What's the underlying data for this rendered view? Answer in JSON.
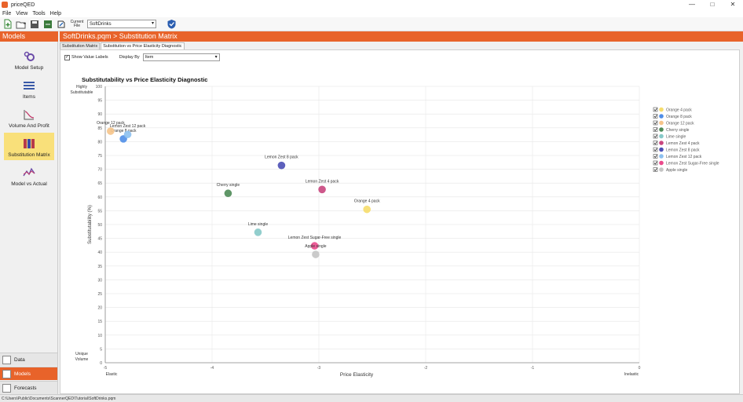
{
  "app": {
    "title": "priceQED",
    "menu": [
      "File",
      "View",
      "Tools",
      "Help"
    ],
    "window_controls": [
      "—",
      "□",
      "✕"
    ]
  },
  "toolbar": {
    "current_file_label": "Current File",
    "current_file_value": "SoftDrinks"
  },
  "left_header": "Models",
  "main_header": "SoftDrinks.pqm > Substitution Matrix",
  "nav": [
    {
      "label": "Model Setup",
      "icon": "model-setup-icon"
    },
    {
      "label": "Items",
      "icon": "items-icon"
    },
    {
      "label": "Volume And Profit",
      "icon": "volume-profit-icon"
    },
    {
      "label": "Substitution Matrix",
      "icon": "substitution-matrix-icon",
      "active": true
    },
    {
      "label": "Model vs Actual",
      "icon": "model-vs-actual-icon"
    }
  ],
  "bottom_tabs": [
    {
      "label": "Data",
      "active": false
    },
    {
      "label": "Models",
      "active": true
    },
    {
      "label": "Forecasts",
      "active": false
    }
  ],
  "tabs": [
    {
      "label": "Substitution Matrix",
      "active": false
    },
    {
      "label": "Substitution vs Price Elasticity Diagnostic",
      "active": true
    }
  ],
  "controls": {
    "show_value_labels": "Show Value Labels",
    "show_value_labels_checked": true,
    "display_by_label": "Display By",
    "display_by_value": "Item"
  },
  "status_path": "C:\\Users\\Public\\Documents\\ScannerQED\\Tutorial\\SoftDrinks.pqm",
  "chart_data": {
    "type": "scatter",
    "title": "Substitutability vs Price Elasticity Diagnostic",
    "xlabel": "Price Elasticity",
    "ylabel": "Substitutability (%)",
    "xlim": [
      -5,
      0
    ],
    "ylim": [
      0,
      100
    ],
    "x_ticks": [
      -5,
      -4,
      -3,
      -2,
      -1,
      0
    ],
    "y_ticks": [
      0,
      5,
      10,
      15,
      20,
      25,
      30,
      35,
      40,
      45,
      50,
      55,
      60,
      65,
      70,
      75,
      80,
      85,
      90,
      95,
      100
    ],
    "y_top_annotation": "Highly Substitutable",
    "y_bottom_annotation": "Unique Volume",
    "x_left_annotation": "Elastic",
    "x_right_annotation": "Inelastic",
    "grid": true,
    "legend_position": "right",
    "points": [
      {
        "name": "Orange 4 pack",
        "x": -2.55,
        "y": 55.5,
        "color": "#f6dd6b"
      },
      {
        "name": "Orange 8 pack",
        "x": -4.83,
        "y": 81.0,
        "color": "#4f8ee8"
      },
      {
        "name": "Orange 12 pack",
        "x": -4.95,
        "y": 83.8,
        "color": "#f6c48a"
      },
      {
        "name": "Cherry single",
        "x": -3.85,
        "y": 61.3,
        "color": "#4e8b57"
      },
      {
        "name": "Lime single",
        "x": -3.57,
        "y": 47.2,
        "color": "#86c9c8"
      },
      {
        "name": "Lemon Zest 4 pack",
        "x": -2.97,
        "y": 62.7,
        "color": "#c9467e"
      },
      {
        "name": "Lemon Zest 8 pack",
        "x": -3.35,
        "y": 71.4,
        "color": "#4b4fb5"
      },
      {
        "name": "Lemon Zest 12 pack",
        "x": -4.79,
        "y": 82.6,
        "color": "#8cc0f0"
      },
      {
        "name": "Lemon Zest Sugar-Free single",
        "x": -3.04,
        "y": 42.3,
        "color": "#ea4a8c"
      },
      {
        "name": "Apple single",
        "x": -3.03,
        "y": 39.2,
        "color": "#c4c4c4"
      }
    ]
  }
}
